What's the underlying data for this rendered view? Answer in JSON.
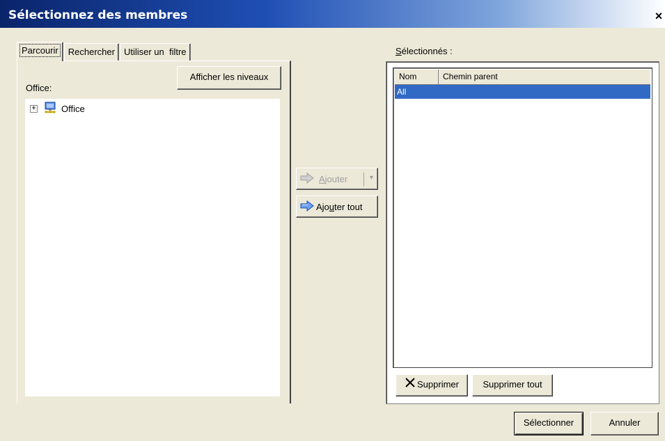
{
  "window": {
    "title": "Sélectionnez des membres",
    "close_glyph": "×"
  },
  "tabs": [
    {
      "label": "Parcourir",
      "active": true
    },
    {
      "label": "Rechercher",
      "active": false
    },
    {
      "label": "Utiliser un  filtre",
      "active": false
    }
  ],
  "browse": {
    "levels_button": "Afficher les niveaux",
    "dimension_label": "Office:",
    "tree": [
      {
        "label": "Office",
        "expander": "+",
        "icon": "network-computer-icon"
      }
    ]
  },
  "middle": {
    "add_label_prefix": "",
    "add_mnemonic": "A",
    "add_label_rest": "jouter",
    "add_enabled": false,
    "add_all_prefix": "Ajo",
    "add_all_mnemonic": "u",
    "add_all_rest": "ter tout"
  },
  "selected": {
    "label_mnemonic": "S",
    "label_rest": "électionnés :",
    "columns": [
      "Nom",
      "Chemin parent"
    ],
    "rows": [
      {
        "name": "All",
        "parent": "",
        "selected": true
      }
    ],
    "remove_button": "Supprimer",
    "remove_all_button": "Supprimer tout"
  },
  "footer": {
    "select_button": "Sélectionner",
    "cancel_button": "Annuler"
  },
  "colors": {
    "title_gradient_start": "#0a246a",
    "dialog_bg": "#ece9d8",
    "selection": "#316ac5"
  }
}
